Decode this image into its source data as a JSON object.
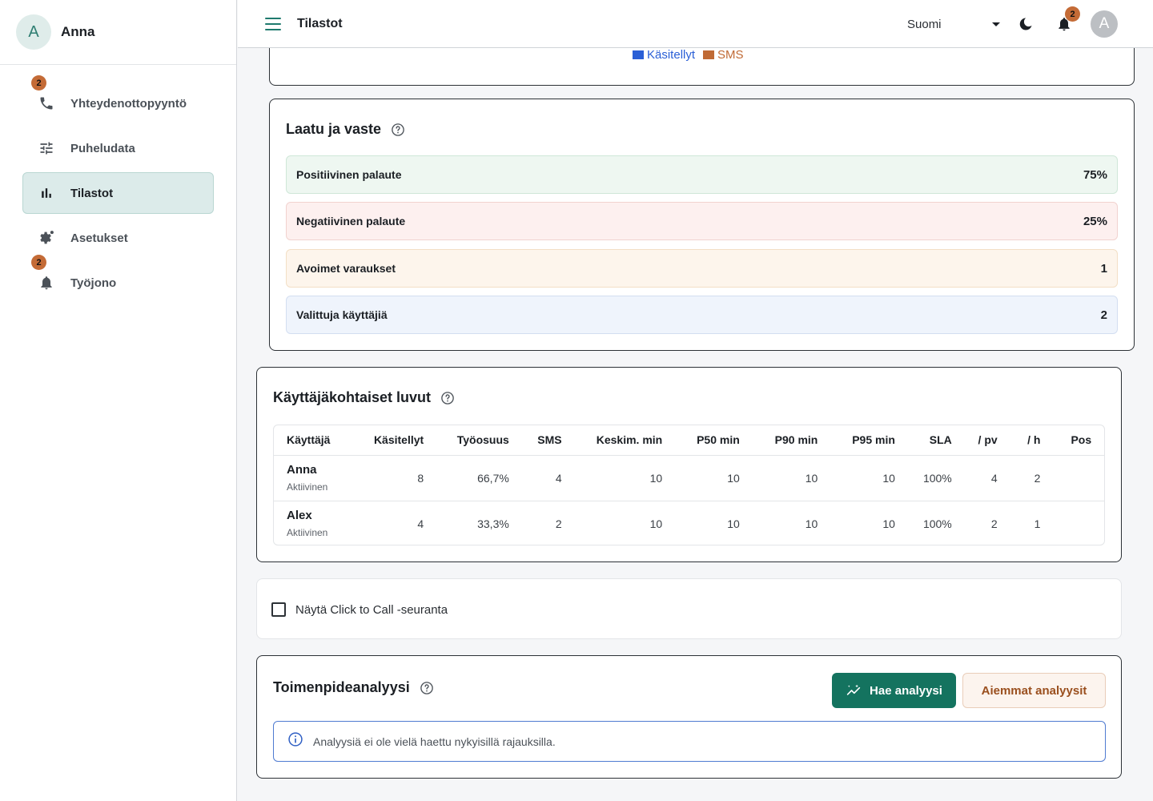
{
  "sidebar": {
    "user": {
      "initial": "A",
      "name": "Anna"
    },
    "items": [
      {
        "label": "Yhteydenottopyyntö",
        "icon": "phone-icon",
        "badge": "2"
      },
      {
        "label": "Puheludata",
        "icon": "sliders-icon"
      },
      {
        "label": "Tilastot",
        "icon": "bar-chart-icon",
        "active": true
      },
      {
        "label": "Asetukset",
        "icon": "gear-icon"
      },
      {
        "label": "Työjono",
        "icon": "bell-icon",
        "badge": "2"
      }
    ]
  },
  "header": {
    "title": "Tilastot",
    "language": "Suomi",
    "notification_count": "2",
    "avatar_initial": "A"
  },
  "legend": {
    "items": [
      {
        "label": "Käsitellyt",
        "color": "#2a5fd6"
      },
      {
        "label": "SMS",
        "color": "#c06a35"
      }
    ]
  },
  "quality": {
    "title": "Laatu ja vaste",
    "rows": [
      {
        "label": "Positiivinen palaute",
        "value": "75%",
        "bg": "#eef7f1",
        "border": "#cfe7d8"
      },
      {
        "label": "Negatiivinen palaute",
        "value": "25%",
        "bg": "#fdf0ef",
        "border": "#f1d2cf"
      },
      {
        "label": "Avoimet varaukset",
        "value": "1",
        "bg": "#fdf5ec",
        "border": "#f3dfc6"
      },
      {
        "label": "Valittuja käyttäjiä",
        "value": "2",
        "bg": "#eff4fc",
        "border": "#d3def1"
      }
    ]
  },
  "users_table": {
    "title": "Käyttäjäkohtaiset luvut",
    "columns": [
      "Käyttäjä",
      "Käsitellyt",
      "Työosuus",
      "SMS",
      "Keskim. min",
      "P50 min",
      "P90 min",
      "P95 min",
      "SLA",
      "/ pv",
      "/ h",
      "Pos"
    ],
    "rows": [
      {
        "name": "Anna",
        "status": "Aktiivinen",
        "cells": [
          "8",
          "66,7%",
          "4",
          "10",
          "10",
          "10",
          "10",
          "100%",
          "4",
          "2",
          ""
        ]
      },
      {
        "name": "Alex",
        "status": "Aktiivinen",
        "cells": [
          "4",
          "33,3%",
          "2",
          "10",
          "10",
          "10",
          "10",
          "100%",
          "2",
          "1",
          ""
        ]
      }
    ]
  },
  "click_to_call": {
    "label": "Näytä Click to Call -seuranta",
    "checked": false
  },
  "analysis": {
    "title": "Toimenpideanalyysi",
    "primary_button": "Hae analyysi",
    "secondary_button": "Aiemmat analyysit",
    "info_text": "Analyysiä ei ole vielä haettu nykyisillä rajauksilla."
  }
}
